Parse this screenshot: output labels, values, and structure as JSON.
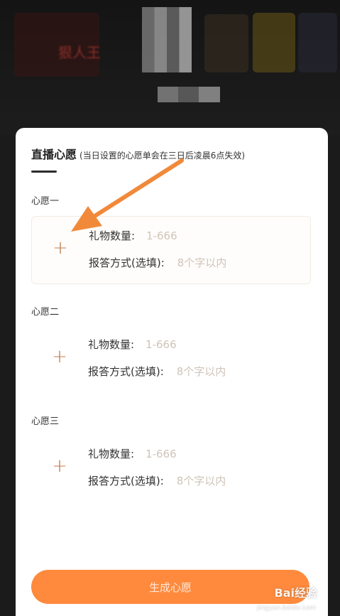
{
  "background": {
    "blurred_text": "狠人王"
  },
  "header": {
    "title": "直播心愿",
    "subtitle": "(当日设置的心愿单会在三日后凌晨6点失效)"
  },
  "wishes": [
    {
      "label": "心愿一",
      "gift_count_label": "礼物数量:",
      "gift_count_placeholder": "1-666",
      "reply_label": "报答方式(选填):",
      "reply_placeholder": "8个字以内"
    },
    {
      "label": "心愿二",
      "gift_count_label": "礼物数量:",
      "gift_count_placeholder": "1-666",
      "reply_label": "报答方式(选填):",
      "reply_placeholder": "8个字以内"
    },
    {
      "label": "心愿三",
      "gift_count_label": "礼物数量:",
      "gift_count_placeholder": "1-666",
      "reply_label": "报答方式(选填):",
      "reply_placeholder": "8个字以内"
    }
  ],
  "actions": {
    "generate_label": "生成心愿"
  },
  "icons": {
    "add": "plus-icon"
  },
  "colors": {
    "accent": "#ff8a3d",
    "plus": "#c07a4a",
    "placeholder": "#cfc4b8",
    "arrow": "#f08a3a"
  },
  "watermark": {
    "text": "Bai经验",
    "sub": "jingyan.baidu.com"
  }
}
